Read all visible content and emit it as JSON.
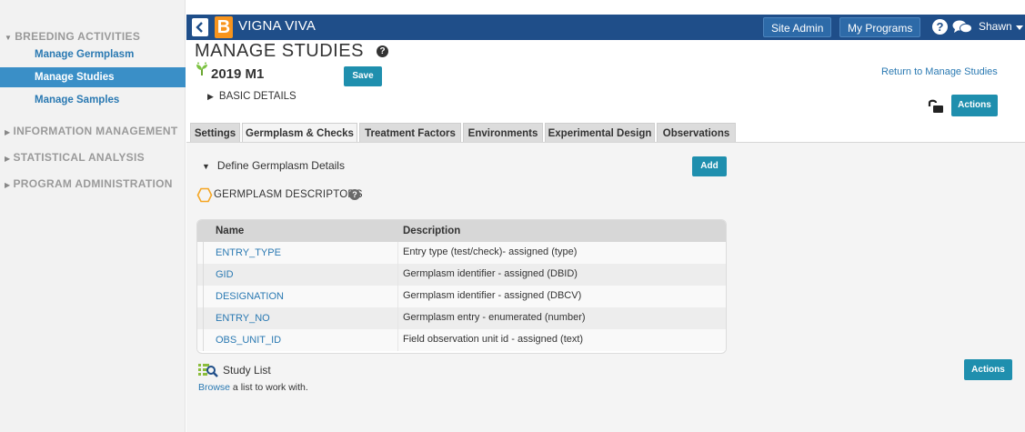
{
  "sidebar": {
    "sections": [
      {
        "label": "BREEDING ACTIVITIES",
        "expanded": true
      },
      {
        "label": "INFORMATION MANAGEMENT",
        "expanded": false
      },
      {
        "label": "STATISTICAL ANALYSIS",
        "expanded": false
      },
      {
        "label": "PROGRAM ADMINISTRATION",
        "expanded": false
      }
    ],
    "items": [
      {
        "label": "Manage Germplasm",
        "active": false
      },
      {
        "label": "Manage Studies",
        "active": true
      },
      {
        "label": "Manage Samples",
        "active": false
      }
    ]
  },
  "topbar": {
    "logo_letter": "B",
    "app_title": "VIGNA VIVA",
    "site_admin": "Site Admin",
    "my_programs": "My Programs",
    "help_glyph": "?",
    "username": "Shawn",
    "color": "#1f4e89",
    "logo_color": "#f7941d"
  },
  "header": {
    "page_title": "MANAGE STUDIES",
    "page_help_glyph": "?",
    "study_name": "2019 M1",
    "save_label": "Save",
    "basic_details": "BASIC DETAILS",
    "return_link": "Return to Manage Studies",
    "actions_label": "Actions"
  },
  "tabs": [
    {
      "label": "Settings",
      "active": false
    },
    {
      "label": "Germplasm & Checks",
      "active": true
    },
    {
      "label": "Treatment Factors",
      "active": false
    },
    {
      "label": "Environments",
      "active": false
    },
    {
      "label": "Experimental Design",
      "active": false
    },
    {
      "label": "Observations",
      "active": false
    }
  ],
  "germplasm": {
    "define_label": "Define Germplasm Details",
    "add_label": "Add",
    "descriptors_title": "GERMPLASM DESCRIPTORS",
    "help_glyph": "?",
    "table": {
      "columns": [
        "Name",
        "Description"
      ],
      "rows": [
        {
          "name": "ENTRY_TYPE",
          "description": "Entry type (test/check)- assigned (type)"
        },
        {
          "name": "GID",
          "description": "Germplasm identifier - assigned (DBID)"
        },
        {
          "name": "DESIGNATION",
          "description": "Germplasm identifier - assigned (DBCV)"
        },
        {
          "name": "ENTRY_NO",
          "description": "Germplasm entry - enumerated (number)"
        },
        {
          "name": "OBS_UNIT_ID",
          "description": "Field observation unit id - assigned (text)"
        }
      ]
    }
  },
  "study_list": {
    "title": "Study List",
    "browse_link": "Browse",
    "browse_suffix": " a list to work with.",
    "actions_label": "Actions"
  },
  "colors": {
    "accent_teal": "#1f8fae",
    "link_blue": "#2a79b2",
    "sidebar_active": "#3a8fc7"
  }
}
